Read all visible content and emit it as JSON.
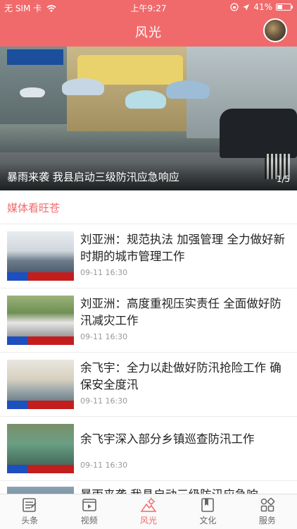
{
  "status_bar": {
    "carrier": "无 SIM 卡",
    "time": "上午9:27",
    "battery": "41%",
    "battery_level": 0.41
  },
  "header": {
    "title": "风光"
  },
  "banner": {
    "caption": "暴雨来袭 我县启动三级防汛应急响应",
    "pager": "1/5"
  },
  "section": {
    "title": "媒体看旺苍"
  },
  "articles": [
    {
      "title": "刘亚洲：规范执法 加强管理 全力做好新时期的城市管理工作",
      "date": "09-11 16:30"
    },
    {
      "title": "刘亚洲：高度重视压实责任 全面做好防汛减灾工作",
      "date": "09-11 16:30"
    },
    {
      "title": "余飞宇：全力以赴做好防汛抢险工作 确保安全度汛",
      "date": "09-11 16:30"
    },
    {
      "title": "余飞宇深入部分乡镇巡查防汛工作",
      "date": "09-11 16:30"
    },
    {
      "title": "暴雨来袭 我县启动三级防汛应急响",
      "date": ""
    }
  ],
  "tabbar": {
    "items": [
      {
        "label": "头条",
        "icon": "news-icon"
      },
      {
        "label": "视频",
        "icon": "video-icon"
      },
      {
        "label": "风光",
        "icon": "scenery-icon"
      },
      {
        "label": "文化",
        "icon": "book-icon"
      },
      {
        "label": "服务",
        "icon": "services-icon"
      }
    ],
    "active_index": 2
  },
  "colors": {
    "accent": "#f06a6c"
  }
}
